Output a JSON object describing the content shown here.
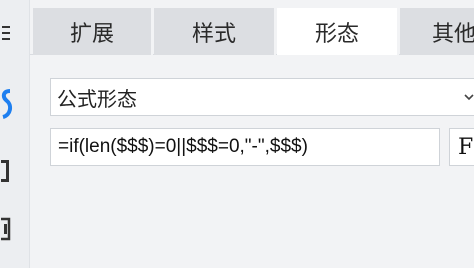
{
  "tabs": [
    {
      "label": "扩展",
      "active": false
    },
    {
      "label": "样式",
      "active": false
    },
    {
      "label": "形态",
      "active": true
    },
    {
      "label": "其他",
      "active": false
    }
  ],
  "form": {
    "mode_select_value": "公式形态",
    "formula_value": "=if(len($$$)=0||$$$=0,\"-\",$$$)",
    "formula_button_label": "F"
  },
  "sidebar": {
    "icons": [
      "menu-icon",
      "style-icon",
      "bracket-icon",
      "box-icon"
    ]
  },
  "colors": {
    "accent": "#1e7ff0",
    "tab_inactive": "#dcdee2",
    "tab_active": "#ffffff",
    "panel_bg": "#f2f3f5"
  }
}
